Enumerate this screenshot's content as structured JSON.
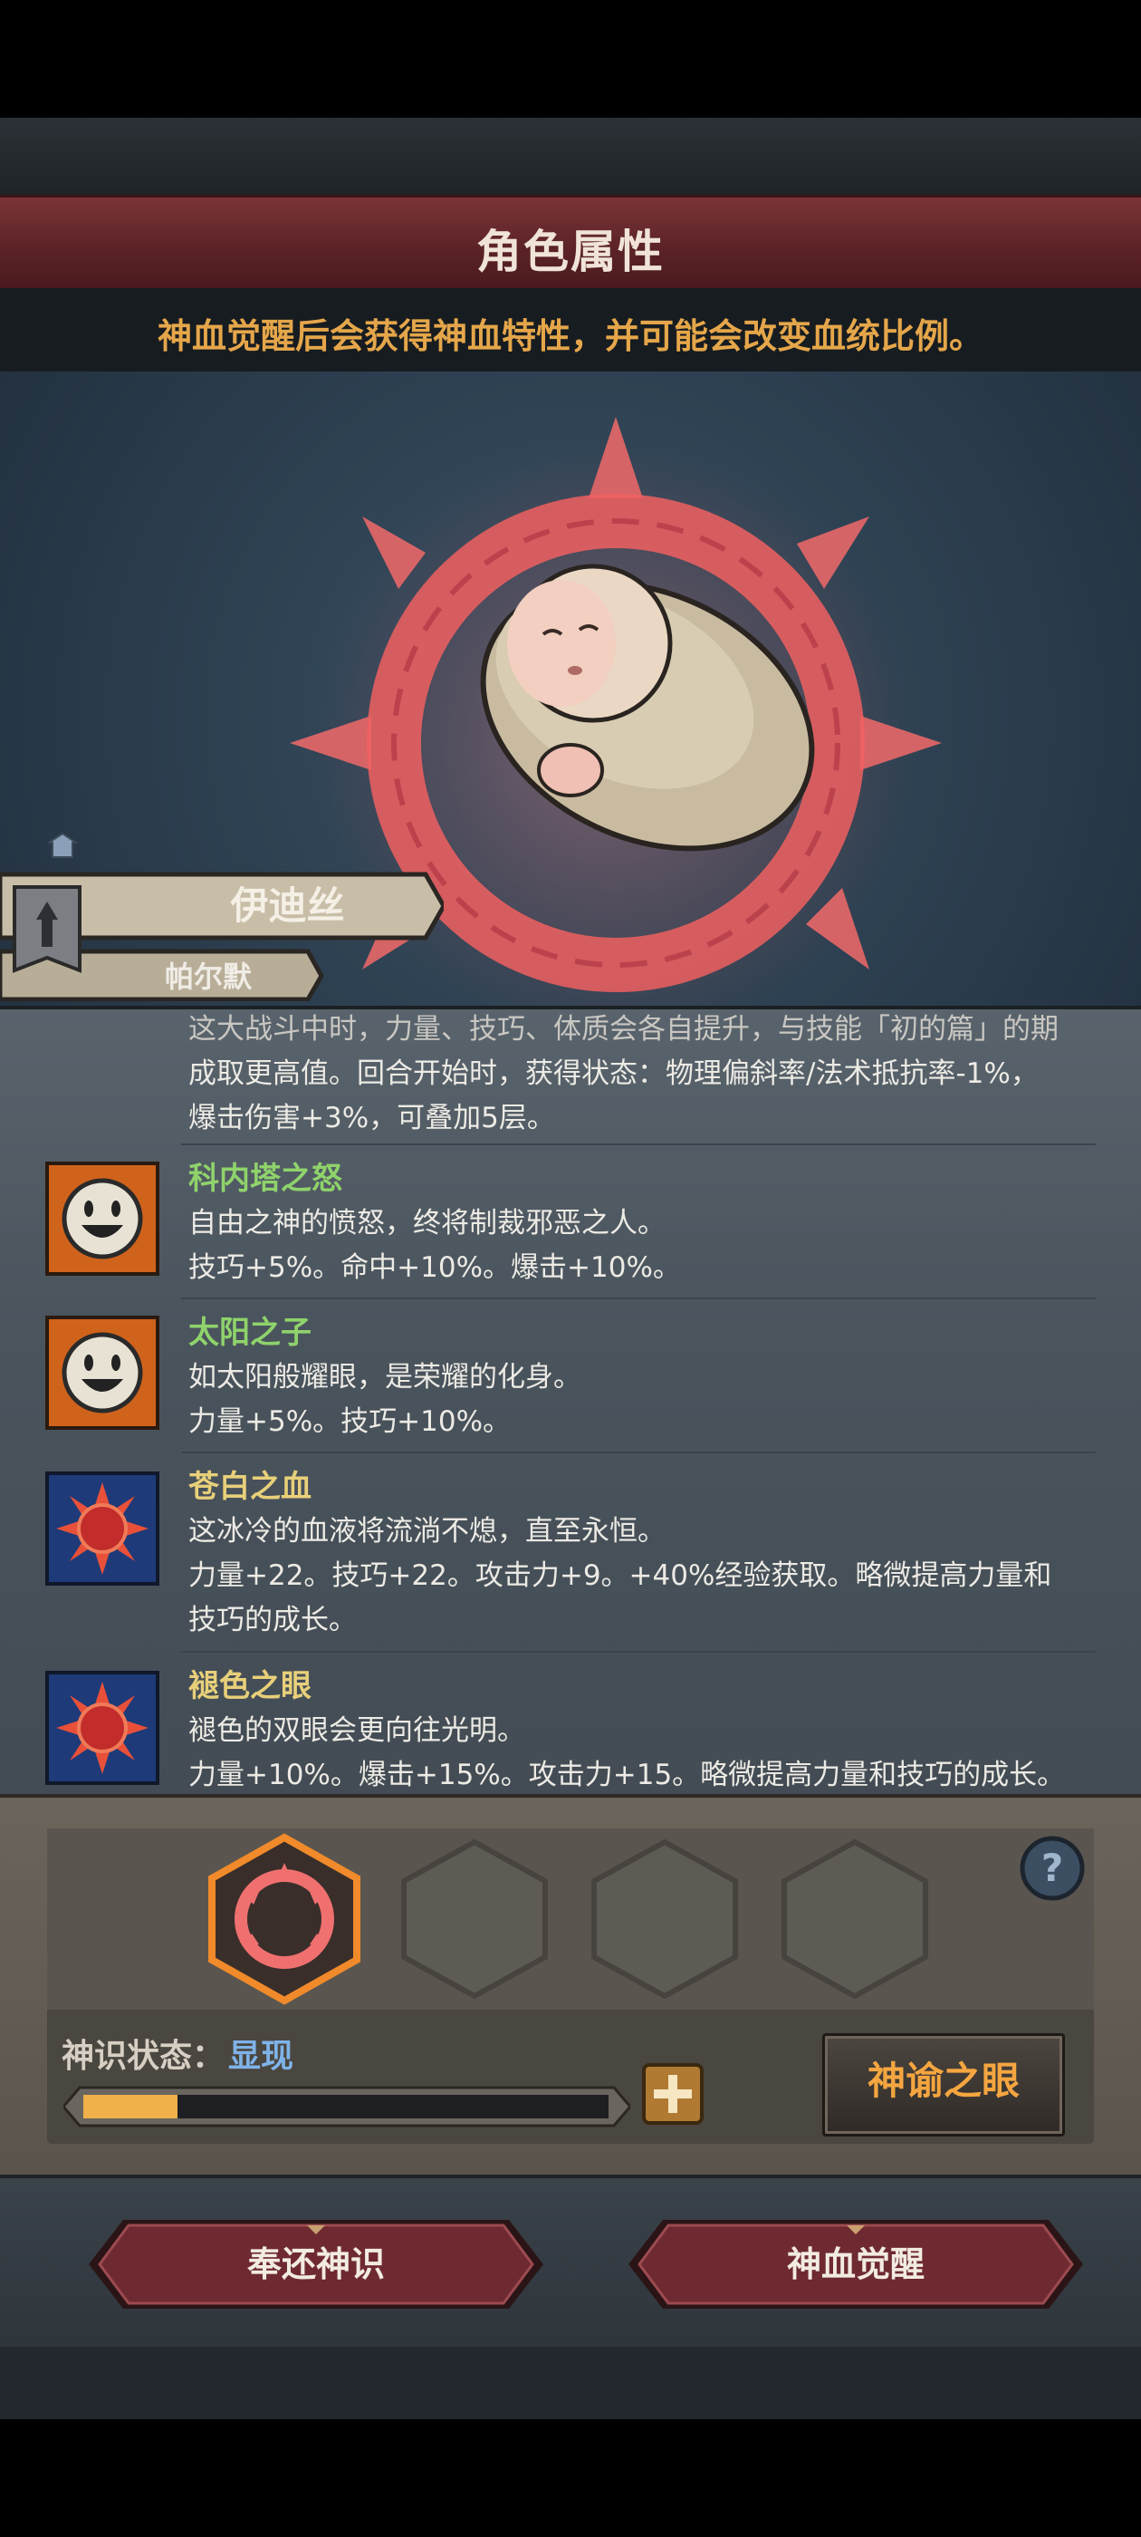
{
  "header": {
    "title": "角色属性",
    "hint": "神血觉醒后会获得神血特性，并可能会改变血统比例。"
  },
  "character": {
    "name": "伊迪丝",
    "family": "帕尔默"
  },
  "traits": {
    "partial_lines": [
      "这大战斗中时，力量、技巧、体质会各自提升，与技能「初的篇」的期",
      "成取更高值。回合开始时，获得状态：物理偏斜率/法术抵抗率-1%，",
      "爆击伤害+3%，可叠加5层。"
    ],
    "items": [
      {
        "name": "科内塔之怒",
        "icon": "smiley-face-icon",
        "lines": [
          "自由之神的愤怒，终将制裁邪恶之人。",
          "技巧+5%。命中+10%。爆击+10%。"
        ]
      },
      {
        "name": "太阳之子",
        "icon": "smiley-face-icon",
        "lines": [
          "如太阳般耀眼，是荣耀的化身。",
          "力量+5%。技巧+10%。"
        ]
      },
      {
        "name": "苍白之血",
        "icon": "red-sun-icon",
        "lines": [
          "这冰冷的血液将流淌不熄，直至永恒。",
          "力量+22。技巧+22。攻击力+9。+40%经验获取。略微提高力量和",
          "技巧的成长。"
        ]
      },
      {
        "name": "褪色之眼",
        "icon": "red-sun-icon",
        "lines": [
          "褪色的双眼会更向往光明。",
          "力量+10%。爆击+15%。攻击力+15。略微提高力量和技巧的成长。"
        ]
      }
    ]
  },
  "divine": {
    "status_label": "神识状态：",
    "status_value": "显现",
    "progress": 0.18,
    "oracle_button": "神谕之眼"
  },
  "actions": {
    "return_label": "奉还神识",
    "awaken_label": "神血觉醒"
  },
  "colors": {
    "title_bar": "#5a2226",
    "hint_text": "#e5a64a",
    "trait_green": "#8fd36b",
    "trait_yellow": "#e8d07a",
    "progress_fill": "#f0b04a",
    "status_value": "#7fb3e8"
  }
}
